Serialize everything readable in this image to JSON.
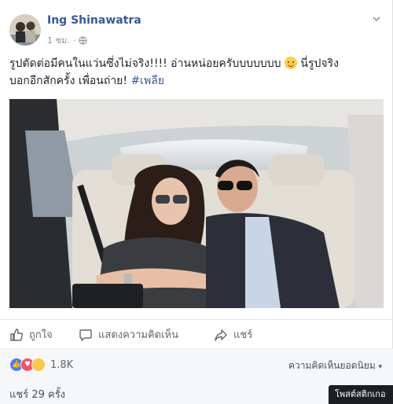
{
  "post": {
    "author": "Ing Shinawatra",
    "time": "1 ชม.",
    "visibility_icon": "globe-icon",
    "caption_text": "รูปตัดต่อมีคนในแว่นซึ่งไม่จริง!!!! อ่านหน่อยครับบบบบบบ ",
    "caption_text2": " นี่รูปจริง\nบอกอีกสักครั้ง เพื่อนถ่าย! ",
    "hashtag": "#เพลีย",
    "emoji": "smiling-face-emoji"
  },
  "actions": {
    "like": "ถูกใจ",
    "comment": "แสดงความคิดเห็น",
    "share": "แชร์"
  },
  "stats": {
    "reaction_count": "1.8K",
    "reactions": [
      "like",
      "love",
      "haha"
    ],
    "sort_label": "ความคิดเห็นยอดนิยม",
    "shares": "แชร์ 29 ครั้ง"
  },
  "tooltip": "โพสต์สติกเกอ",
  "colors": {
    "link": "#365899",
    "like": "#4d7cf3",
    "love": "#f25268",
    "haha": "#f7c84b"
  }
}
